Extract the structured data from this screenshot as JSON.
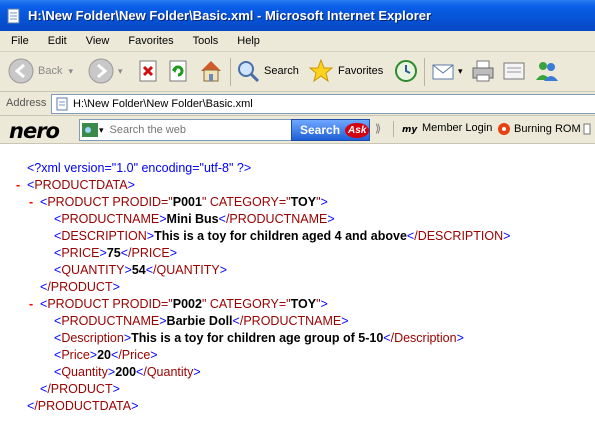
{
  "window": {
    "title": "H:\\New Folder\\New Folder\\Basic.xml - Microsoft Internet Explorer"
  },
  "menu": [
    "File",
    "Edit",
    "View",
    "Favorites",
    "Tools",
    "Help"
  ],
  "toolbar": {
    "back": "Back",
    "search": "Search",
    "favorites": "Favorites"
  },
  "address": {
    "label": "Address",
    "value": "H:\\New Folder\\New Folder\\Basic.xml"
  },
  "nero": {
    "logo": "nero",
    "search_placeholder": "Search the web",
    "search_button": "Search",
    "ask_badge": "Ask",
    "member_login": "Member Login",
    "burning_rom": "Burning ROM"
  },
  "xml": {
    "declaration": "<?xml version=\"1.0\" encoding=\"utf-8\" ?>",
    "minus": "-",
    "root_open": "PRODUCTDATA",
    "root_close": "/PRODUCTDATA",
    "products": [
      {
        "open_name": "PRODUCT",
        "attr1_name": "PRODID=\"",
        "attr1_value": "P001",
        "attr2_name": "\" CATEGORY=\"",
        "attr2_value": "TOY",
        "attr_end": "\"",
        "close": "/PRODUCT",
        "fields": [
          {
            "tag": "PRODUCTNAME",
            "value": "Mini Bus",
            "close": "/PRODUCTNAME"
          },
          {
            "tag": "DESCRIPTION",
            "value": "This is a toy for children aged 4 and above",
            "close": "/DESCRIPTION"
          },
          {
            "tag": "PRICE",
            "value": "75",
            "close": "/PRICE"
          },
          {
            "tag": "QUANTITY",
            "value": "54",
            "close": "/QUANTITY"
          }
        ]
      },
      {
        "open_name": "PRODUCT",
        "attr1_name": "PRODID=\"",
        "attr1_value": "P002",
        "attr2_name": "\" CATEGORY=\"",
        "attr2_value": "TOY",
        "attr_end": "\"",
        "close": "/PRODUCT",
        "fields": [
          {
            "tag": "PRODUCTNAME",
            "value": "Barbie Doll",
            "close": "/PRODUCTNAME"
          },
          {
            "tag": "Description",
            "value": "This is a toy for children age group of 5-10",
            "close": "/Description"
          },
          {
            "tag": "Price",
            "value": "20",
            "close": "/Price"
          },
          {
            "tag": "Quantity",
            "value": "200",
            "close": "/Quantity"
          }
        ]
      }
    ]
  }
}
